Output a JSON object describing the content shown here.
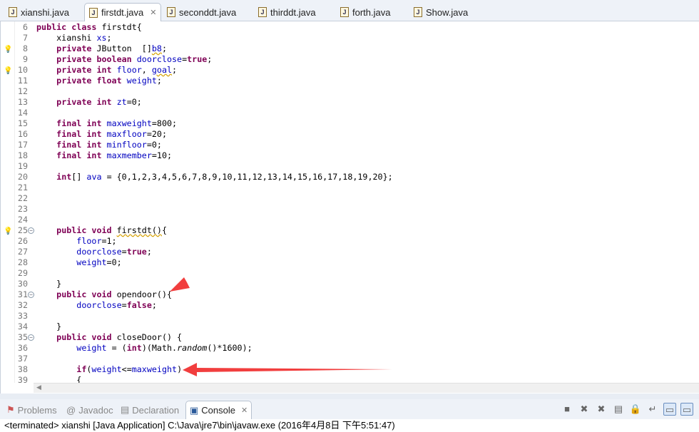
{
  "tabs": [
    {
      "label": "xianshi.java",
      "active": false
    },
    {
      "label": "firstdt.java",
      "active": true,
      "close": "✕"
    },
    {
      "label": "seconddt.java",
      "active": false
    },
    {
      "label": "thirddt.java",
      "active": false
    },
    {
      "label": "forth.java",
      "active": false
    },
    {
      "label": "Show.java",
      "active": false
    }
  ],
  "editor": {
    "lines": [
      {
        "n": "6",
        "t": [
          [
            "k",
            "public class "
          ],
          [
            "p",
            "firstdt{"
          ]
        ]
      },
      {
        "n": "7",
        "t": [
          [
            "p",
            "    xianshi "
          ],
          [
            "f",
            "xs"
          ],
          [
            "p",
            ";"
          ]
        ]
      },
      {
        "n": "8",
        "warn": true,
        "t": [
          [
            "p",
            "    "
          ],
          [
            "k",
            "private "
          ],
          [
            "p",
            "JButton  []"
          ],
          [
            "fu",
            "b8"
          ],
          [
            "p",
            ";"
          ]
        ]
      },
      {
        "n": "9",
        "t": [
          [
            "p",
            "    "
          ],
          [
            "k",
            "private boolean "
          ],
          [
            "f",
            "doorclose"
          ],
          [
            "p",
            "="
          ],
          [
            "k",
            "true"
          ],
          [
            "p",
            ";"
          ]
        ]
      },
      {
        "n": "10",
        "warn": true,
        "t": [
          [
            "p",
            "    "
          ],
          [
            "k",
            "private int "
          ],
          [
            "f",
            "floor"
          ],
          [
            "p",
            ", "
          ],
          [
            "fu",
            "goal"
          ],
          [
            "p",
            ";"
          ]
        ]
      },
      {
        "n": "11",
        "t": [
          [
            "p",
            "    "
          ],
          [
            "k",
            "private float "
          ],
          [
            "f",
            "weight"
          ],
          [
            "p",
            ";"
          ]
        ]
      },
      {
        "n": "12",
        "t": []
      },
      {
        "n": "13",
        "t": [
          [
            "p",
            "    "
          ],
          [
            "k",
            "private int "
          ],
          [
            "f",
            "zt"
          ],
          [
            "p",
            "=0;"
          ]
        ]
      },
      {
        "n": "14",
        "t": []
      },
      {
        "n": "15",
        "t": [
          [
            "p",
            "    "
          ],
          [
            "k",
            "final int "
          ],
          [
            "f",
            "maxweight"
          ],
          [
            "p",
            "=800;"
          ]
        ]
      },
      {
        "n": "16",
        "t": [
          [
            "p",
            "    "
          ],
          [
            "k",
            "final int "
          ],
          [
            "f",
            "maxfloor"
          ],
          [
            "p",
            "=20;"
          ]
        ]
      },
      {
        "n": "17",
        "t": [
          [
            "p",
            "    "
          ],
          [
            "k",
            "final int "
          ],
          [
            "f",
            "minfloor"
          ],
          [
            "p",
            "=0;"
          ]
        ]
      },
      {
        "n": "18",
        "t": [
          [
            "p",
            "    "
          ],
          [
            "k",
            "final int "
          ],
          [
            "f",
            "maxmember"
          ],
          [
            "p",
            "=10;"
          ]
        ]
      },
      {
        "n": "19",
        "t": []
      },
      {
        "n": "20",
        "t": [
          [
            "p",
            "    "
          ],
          [
            "k",
            "int"
          ],
          [
            "p",
            "[] "
          ],
          [
            "f",
            "ava"
          ],
          [
            "p",
            " = {0,1,2,3,4,5,6,7,8,9,10,11,12,13,14,15,16,17,18,19,20};"
          ]
        ]
      },
      {
        "n": "21",
        "t": []
      },
      {
        "n": "22",
        "t": []
      },
      {
        "n": "23",
        "t": []
      },
      {
        "n": "24",
        "t": []
      },
      {
        "n": "25",
        "warn": true,
        "fold": true,
        "t": [
          [
            "p",
            "    "
          ],
          [
            "k",
            "public void "
          ],
          [
            "pu",
            "firstdt()"
          ],
          [
            "p",
            "{"
          ]
        ]
      },
      {
        "n": "26",
        "t": [
          [
            "p",
            "        "
          ],
          [
            "f",
            "floor"
          ],
          [
            "p",
            "=1;"
          ]
        ]
      },
      {
        "n": "27",
        "t": [
          [
            "p",
            "        "
          ],
          [
            "f",
            "doorclose"
          ],
          [
            "p",
            "="
          ],
          [
            "k",
            "true"
          ],
          [
            "p",
            ";"
          ]
        ]
      },
      {
        "n": "28",
        "t": [
          [
            "p",
            "        "
          ],
          [
            "f",
            "weight"
          ],
          [
            "p",
            "=0;"
          ]
        ]
      },
      {
        "n": "29",
        "t": []
      },
      {
        "n": "30",
        "t": [
          [
            "p",
            "    }"
          ]
        ]
      },
      {
        "n": "31",
        "fold": true,
        "t": [
          [
            "p",
            "    "
          ],
          [
            "k",
            "public void "
          ],
          [
            "p",
            "opendoor(){"
          ]
        ]
      },
      {
        "n": "32",
        "t": [
          [
            "p",
            "        "
          ],
          [
            "f",
            "doorclose"
          ],
          [
            "p",
            "="
          ],
          [
            "k",
            "false"
          ],
          [
            "p",
            ";"
          ]
        ]
      },
      {
        "n": "33",
        "t": []
      },
      {
        "n": "34",
        "t": [
          [
            "p",
            "    }"
          ]
        ]
      },
      {
        "n": "35",
        "fold": true,
        "t": [
          [
            "p",
            "    "
          ],
          [
            "k",
            "public void "
          ],
          [
            "p",
            "closeDoor() {"
          ]
        ]
      },
      {
        "n": "36",
        "t": [
          [
            "p",
            "        "
          ],
          [
            "f",
            "weight"
          ],
          [
            "p",
            " = ("
          ],
          [
            "k",
            "int"
          ],
          [
            "p",
            ")(Math."
          ],
          [
            "i",
            "random"
          ],
          [
            "p",
            "()*1600);"
          ]
        ]
      },
      {
        "n": "37",
        "t": []
      },
      {
        "n": "38",
        "t": [
          [
            "p",
            "        "
          ],
          [
            "k",
            "if"
          ],
          [
            "p",
            "("
          ],
          [
            "f",
            "weight"
          ],
          [
            "p",
            "<="
          ],
          [
            "f",
            "maxweight"
          ],
          [
            "p",
            ")"
          ]
        ]
      },
      {
        "n": "39",
        "t": [
          [
            "p",
            "        {"
          ]
        ]
      }
    ]
  },
  "annotation_color": "#f03434",
  "panel": {
    "tabs": [
      {
        "label": "Problems",
        "icon": "problems-icon",
        "active": false
      },
      {
        "label": "Javadoc",
        "icon": "@",
        "active": false
      },
      {
        "label": "Declaration",
        "icon": "declaration-icon",
        "active": false
      },
      {
        "label": "Console",
        "icon": "console-icon",
        "active": true,
        "close": "✕"
      }
    ],
    "console_text": "<terminated> xianshi [Java Application] C:\\Java\\jre7\\bin\\javaw.exe (2016年4月8日 下午5:51:47)"
  }
}
